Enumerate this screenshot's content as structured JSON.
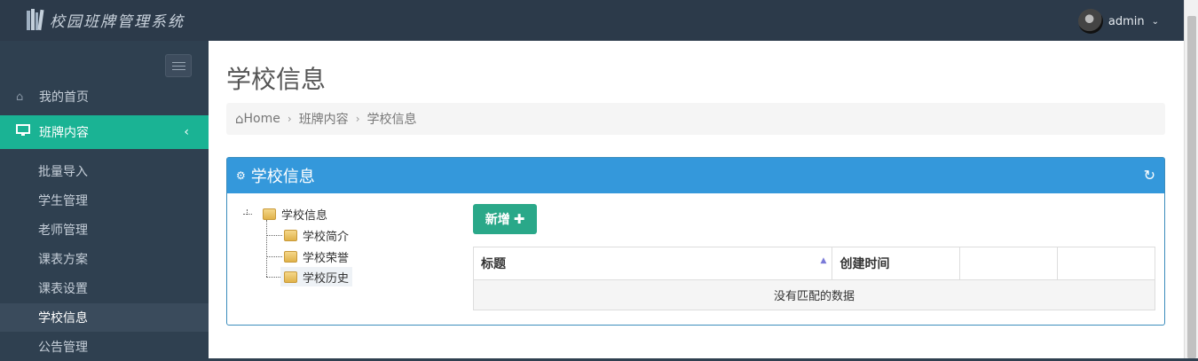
{
  "app": {
    "title": "校园班牌管理系统"
  },
  "user": {
    "name": "admin"
  },
  "sidebar": {
    "items": [
      {
        "label": "我的首页",
        "icon": "home-icon"
      },
      {
        "label": "班牌内容",
        "icon": "monitor-icon"
      }
    ],
    "sub_items": [
      "批量导入",
      "学生管理",
      "老师管理",
      "课表方案",
      "课表设置",
      "学校信息",
      "公告管理"
    ]
  },
  "main": {
    "page_title": "学校信息",
    "breadcrumb": [
      "Home",
      "班牌内容",
      "学校信息"
    ],
    "panel_title": "学校信息",
    "tree": {
      "root": "学校信息",
      "children": [
        "学校简介",
        "学校荣誉",
        "学校历史"
      ]
    },
    "add_button": "新增",
    "table": {
      "columns": [
        "标题",
        "创建时间",
        "",
        ""
      ],
      "empty_text": "没有匹配的数据"
    }
  },
  "colors": {
    "accent": "#1ab394",
    "panel_header": "#3498db",
    "add_button": "#2aa889",
    "sidebar_bg": "#2f4050"
  }
}
